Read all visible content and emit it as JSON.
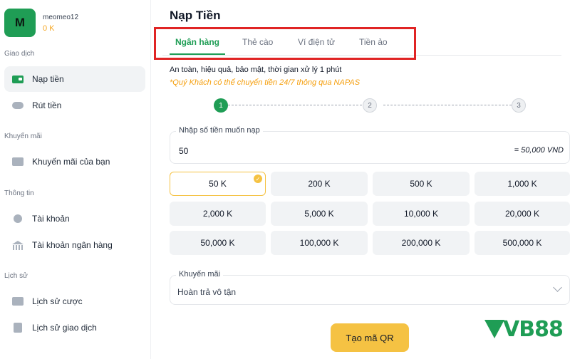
{
  "profile": {
    "avatar_letter": "M",
    "username": "meomeo12",
    "balance": "0 K"
  },
  "sidebar": {
    "sections": [
      {
        "label": "Giao dịch"
      },
      {
        "label": "Khuyến mãi"
      },
      {
        "label": "Thông tin"
      },
      {
        "label": "Lịch sử"
      }
    ],
    "items": [
      {
        "label": "Nạp tiền",
        "icon": "deposit-card-icon",
        "active": true
      },
      {
        "label": "Rút tiền",
        "icon": "withdraw-icon"
      },
      {
        "label": "Khuyến mãi của bạn",
        "icon": "promo-ticket-icon"
      },
      {
        "label": "Tài khoản",
        "icon": "user-icon"
      },
      {
        "label": "Tài khoản ngân hàng",
        "icon": "bank-icon"
      },
      {
        "label": "Lịch sử cược",
        "icon": "bet-history-icon"
      },
      {
        "label": "Lịch sử giao dịch",
        "icon": "transaction-history-icon"
      }
    ]
  },
  "main": {
    "title": "Nạp Tiền",
    "tabs": [
      {
        "label": "Ngân hàng",
        "active": true
      },
      {
        "label": "Thẻ cào"
      },
      {
        "label": "Ví điện tử"
      },
      {
        "label": "Tiền ảo"
      }
    ],
    "info_line": "An toàn, hiệu quả, bảo mật, thời gian xử lý 1 phút",
    "info_note": "*Quý Khách có thể chuyển tiền 24/7 thông qua NAPAS",
    "steps": [
      "1",
      "2",
      "3"
    ],
    "current_step": 1,
    "amount_field": {
      "label": "Nhập số tiền muốn nạp",
      "value": "50",
      "converted": "= 50,000 VND"
    },
    "amount_options": [
      "50 K",
      "200 K",
      "500 K",
      "1,000 K",
      "2,000 K",
      "5,000 K",
      "10,000 K",
      "20,000 K",
      "50,000 K",
      "100,000 K",
      "200,000 K",
      "500,000 K"
    ],
    "selected_option": "50 K",
    "promo_field": {
      "label": "Khuyến mãi",
      "value": "Hoàn trả vô tận"
    },
    "submit_label": "Tạo mã QR"
  },
  "logo": {
    "text": "VB88"
  },
  "colors": {
    "brand_green": "#1f9d55",
    "accent_yellow": "#f5c243",
    "note_orange": "#f59e0b",
    "highlight_red": "#e02424"
  }
}
